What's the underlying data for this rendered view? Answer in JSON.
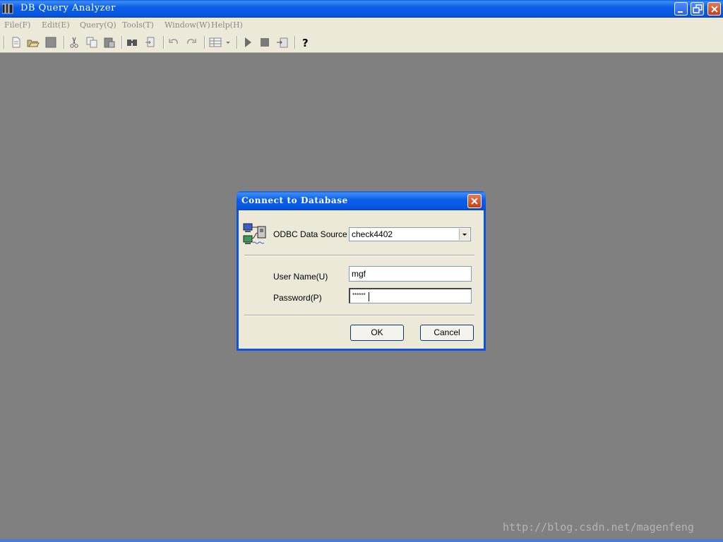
{
  "window": {
    "title": "DB Query Analyzer",
    "icon": "app-books-icon",
    "controls": [
      "minimize-icon",
      "restore-icon",
      "close-icon"
    ]
  },
  "menu": [
    {
      "label": "File(F)"
    },
    {
      "label": "Edit(E)"
    },
    {
      "label": "Query(Q)"
    },
    {
      "label": "Tools(T)"
    },
    {
      "label": "Window(W)"
    },
    {
      "label": "Help(H)"
    }
  ],
  "toolbar": {
    "icons": [
      "new-icon",
      "open-icon",
      "save-icon",
      "cut-icon",
      "copy-icon",
      "paste-icon",
      "find-icon",
      "replace-icon",
      "undo-icon",
      "redo-icon",
      "results-grid-icon",
      "execute-icon",
      "stop-icon",
      "parse-icon",
      "help-icon"
    ]
  },
  "dialog": {
    "title": "Connect to Database",
    "datasource_label": "ODBC Data Source",
    "datasource_value": "check4402",
    "username_label": "User Name(U)",
    "username_value": "mgf",
    "password_label": "Password(P)",
    "password_value": "******",
    "ok_label": "OK",
    "cancel_label": "Cancel"
  },
  "watermark": "http://blog.csdn.net/magenfeng",
  "colors": {
    "titlebar": "#0a54df",
    "workspace": "#808080",
    "dialog_face": "#ece9d8",
    "close_button": "#d65a35"
  }
}
